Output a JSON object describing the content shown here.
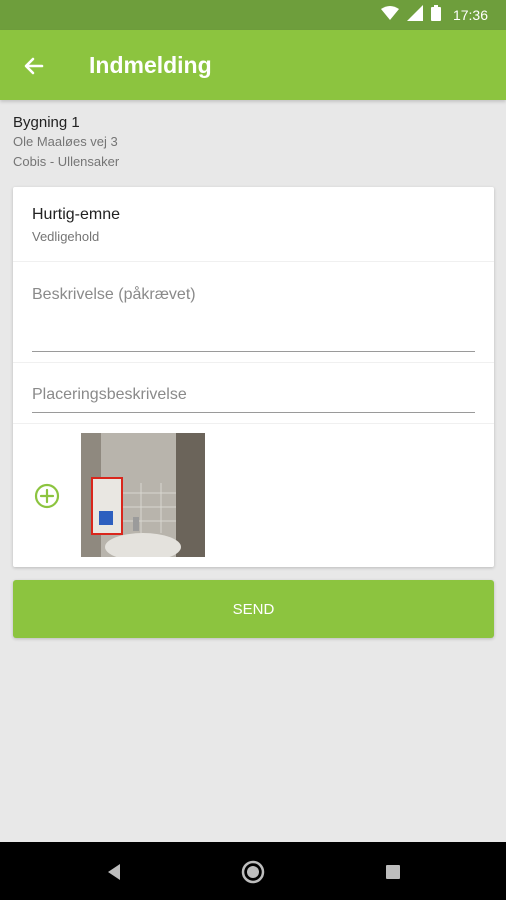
{
  "status_bar": {
    "time": "17:36",
    "icons": [
      "wifi-icon",
      "signal-icon",
      "battery-icon"
    ]
  },
  "app_bar": {
    "title": "Indmelding",
    "back_icon": "arrow-left-icon"
  },
  "building": {
    "name": "Bygning 1",
    "address": "Ole Maaløes vej 3",
    "location": "Cobis - Ullensaker"
  },
  "form": {
    "quick_topic": {
      "label": "Hurtig-emne",
      "value": "Vedligehold"
    },
    "description": {
      "placeholder": "Beskrivelse (påkrævet)"
    },
    "placement": {
      "placeholder": "Placeringsbeskrivelse"
    },
    "add_photo_icon": "add-circle-icon"
  },
  "send_button": {
    "label": "SEND"
  },
  "colors": {
    "primary": "#8cc43f",
    "status_bar": "#6e9e3c",
    "background": "#e8e8e8"
  },
  "nav_bar": {
    "icons": [
      "back-triangle-icon",
      "home-circle-icon",
      "recents-square-icon"
    ]
  }
}
